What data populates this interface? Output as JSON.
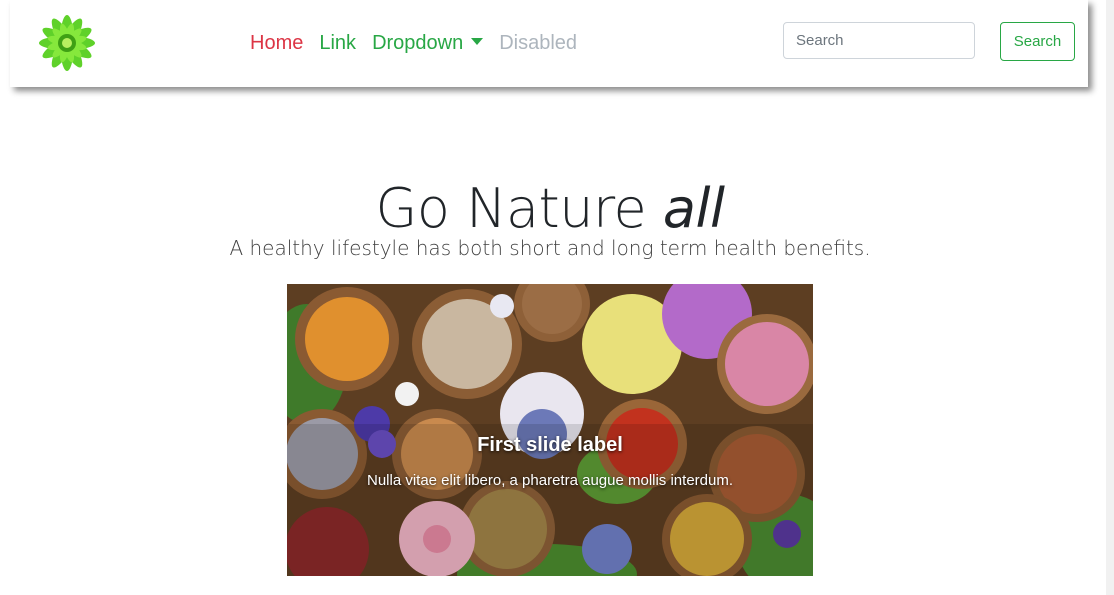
{
  "colors": {
    "accent_red": "#dc3545",
    "accent_green": "#28a745",
    "disabled_gray": "#adb5bd"
  },
  "navbar": {
    "logo_icon": "green-flower-logo-icon",
    "links": {
      "home": "Home",
      "link": "Link",
      "dropdown": "Dropdown",
      "disabled": "Disabled"
    },
    "search": {
      "placeholder": "Search",
      "button_label": "Search"
    }
  },
  "hero": {
    "title_main": "Go Nature",
    "title_emph": "all",
    "subtitle": "A healthy lifestyle has both short and long term health benefits."
  },
  "carousel": {
    "image_description_icon": "herbs-and-flowers-photo",
    "slide": {
      "title": "First slide label",
      "text": "Nulla vitae elit libero, a pharetra augue mollis interdum."
    }
  }
}
